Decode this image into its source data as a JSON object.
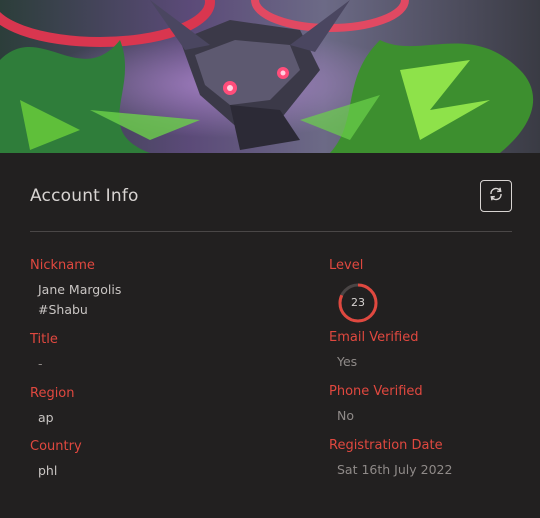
{
  "account": {
    "title": "Account Info",
    "refresh_icon": "refresh-icon",
    "banner_description": "champion-splash-art",
    "fields_left": [
      {
        "label": "Nickname",
        "value_line1": "Jane Margolis",
        "value_line2": "#Shabu"
      },
      {
        "label": "Title",
        "value": "-"
      },
      {
        "label": "Region",
        "value": "ap"
      },
      {
        "label": "Country",
        "value": "phl"
      }
    ],
    "fields_right": [
      {
        "label": "Level",
        "value": "23",
        "progress": 0.82
      },
      {
        "label": "Email Verified",
        "value": "Yes"
      },
      {
        "label": "Phone Verified",
        "value": "No"
      },
      {
        "label": "Registration Date",
        "value": "Sat 16th July 2022"
      }
    ]
  },
  "colors": {
    "accent": "#e0483f",
    "background": "#222020",
    "text": "#d8d4d2"
  }
}
